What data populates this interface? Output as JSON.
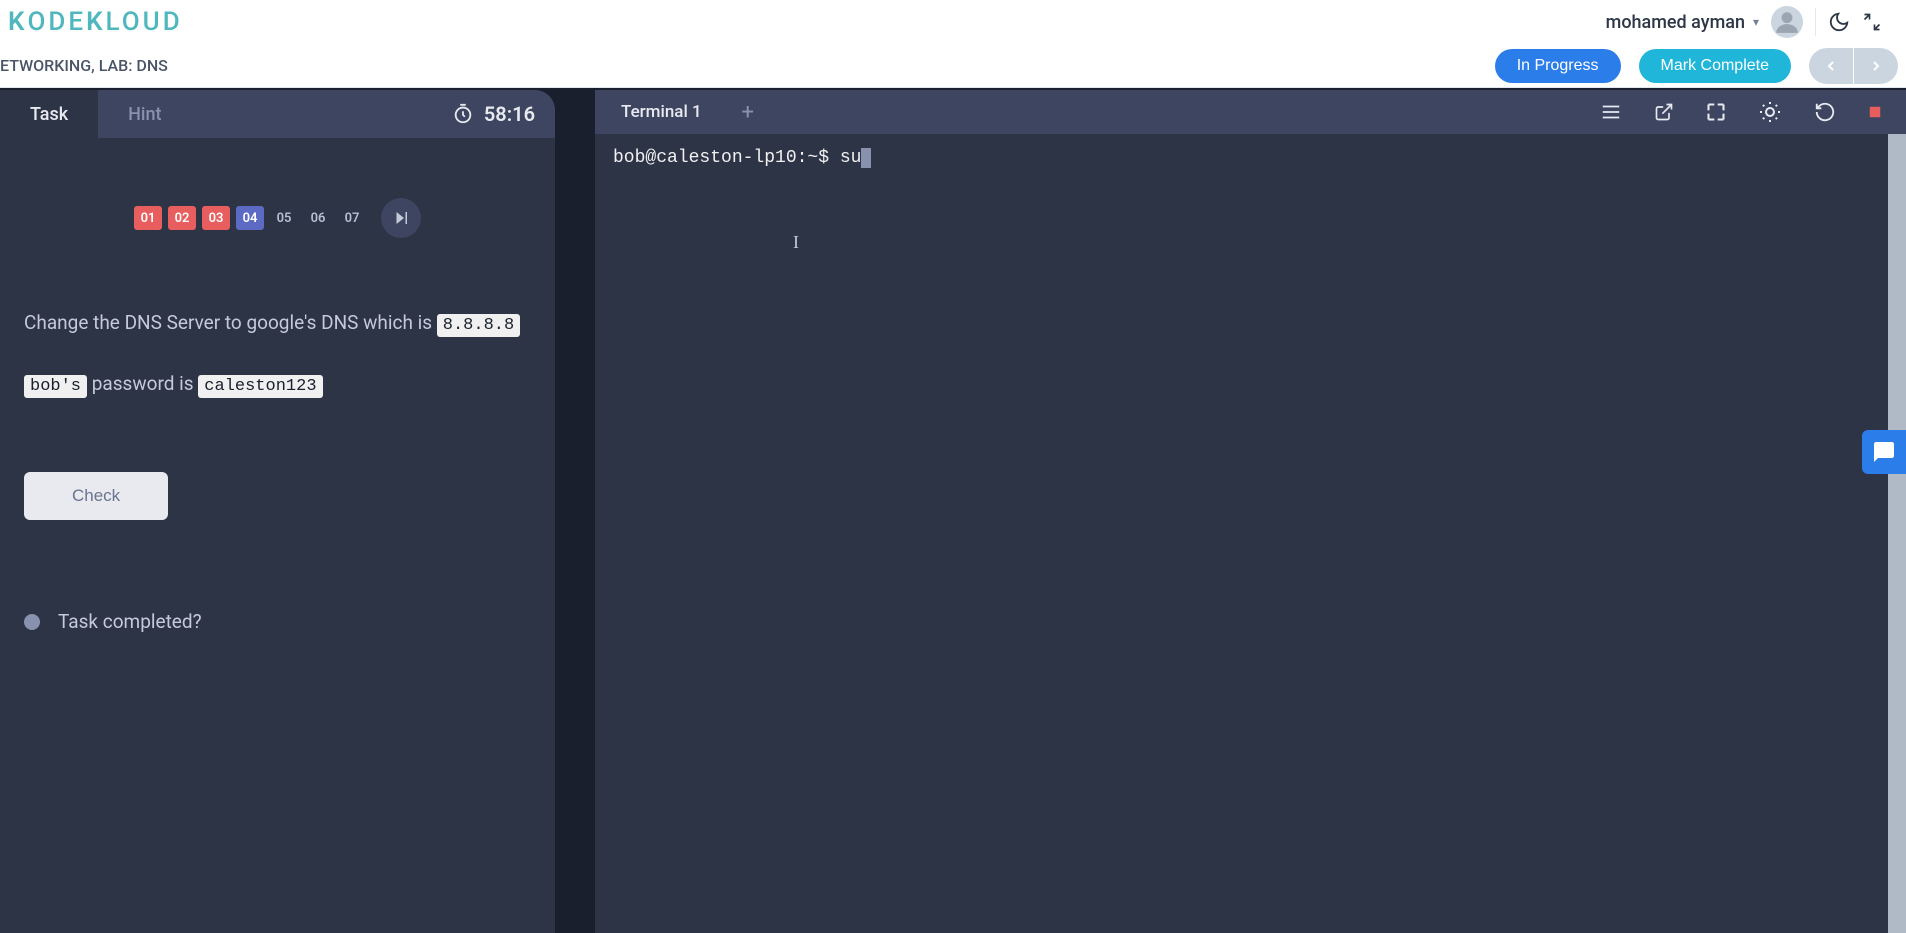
{
  "header": {
    "logo_text": "KODEKLOUD",
    "username": "mohamed ayman"
  },
  "breadcrumb": {
    "path": "ETWORKING, LAB: DNS",
    "in_progress": "In Progress",
    "mark_complete": "Mark Complete"
  },
  "task": {
    "tabs": {
      "task": "Task",
      "hint": "Hint"
    },
    "timer": "58:16",
    "steps": [
      "01",
      "02",
      "03",
      "04",
      "05",
      "06",
      "07"
    ],
    "text_pre": "Change the DNS Server to google's DNS which is ",
    "code_dns": "8.8.8.8",
    "code_user": "bob's",
    "text_mid": " password is ",
    "code_pass": "caleston123",
    "check": "Check",
    "completed": "Task completed?"
  },
  "terminal": {
    "tab_label": "Terminal 1",
    "prompt": "bob@caleston-lp10:~$ su"
  }
}
